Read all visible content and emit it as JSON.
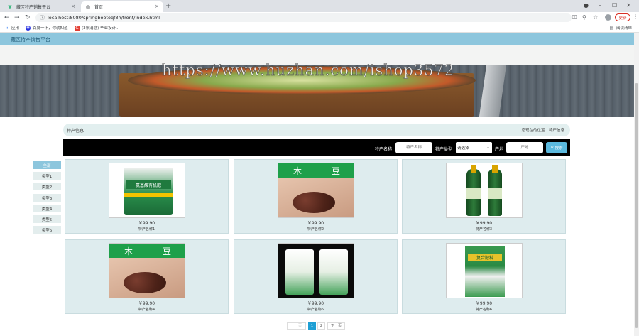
{
  "browser": {
    "tabs": [
      {
        "title": "藏区特产销售平台",
        "icon": "vue-icon"
      },
      {
        "title": "首页",
        "icon": "globe-icon"
      }
    ],
    "url": "localhost:8080/springbootoqf8h/front/index.html",
    "update_label": "更新",
    "bookmarks": [
      {
        "label": "应用",
        "icon": "apps-grid-icon"
      },
      {
        "label": "百度一下，你就知道",
        "icon": "baidu-paw-icon"
      },
      {
        "label": "(3条消息) 毕业设计...",
        "icon": "csdn-c-icon"
      }
    ],
    "reading_list_label": "阅读清单"
  },
  "site": {
    "title": "藏区特产销售平台"
  },
  "banner": {
    "watermark": "https://www.huzhan.com/ishop3572",
    "slide_count": 3,
    "active_slide": 1
  },
  "section": {
    "title": "特产信息",
    "location": "您现在的位置：特产信息"
  },
  "search": {
    "name_label": "特产名称",
    "name_placeholder": "特产名称",
    "type_label": "特产类型",
    "type_value": "请选择",
    "origin_label": "产地",
    "origin_placeholder": "产地",
    "button_label": "搜索"
  },
  "categories": [
    "全部",
    "类型1",
    "类型2",
    "类型3",
    "类型4",
    "类型5",
    "类型6"
  ],
  "active_category": 0,
  "products": [
    {
      "price": "￥99.90",
      "name": "特产名称1",
      "bag_text": "氨基酸有机肥"
    },
    {
      "price": "￥99.90",
      "name": "特产名称2",
      "banner_left": "木",
      "banner_right": "豆"
    },
    {
      "price": "￥99.90",
      "name": "特产名称3"
    },
    {
      "price": "￥99.90",
      "name": "特产名称4",
      "banner_left": "木",
      "banner_right": "豆"
    },
    {
      "price": "￥99.90",
      "name": "特产名称5"
    },
    {
      "price": "￥99.90",
      "name": "特产名称6",
      "bag_text": "复合肥料"
    }
  ],
  "pagination": {
    "prev": "上一页",
    "pages": [
      "1",
      "2"
    ],
    "current": "1",
    "next": "下一页"
  }
}
